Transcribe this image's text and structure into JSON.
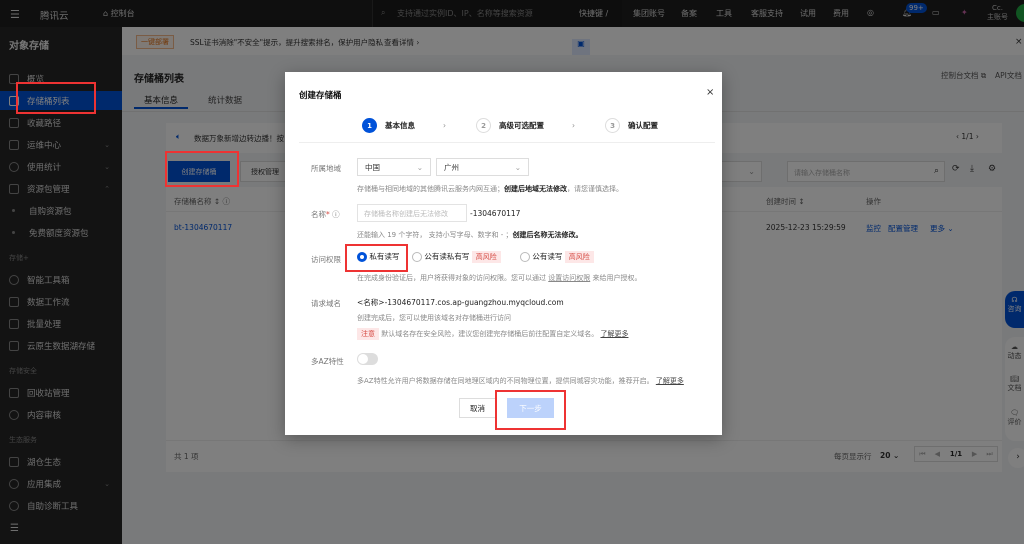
{
  "topbar": {
    "brand": "腾讯云",
    "console": "控制台",
    "search_placeholder": "支持通过实例ID、IP、名称等搜索资源",
    "shortcut": "快捷键 /",
    "nav": [
      "集团账号",
      "备案",
      "工具",
      "客服支持",
      "试用",
      "费用"
    ],
    "badge": "99+",
    "user_line1": "Cc.",
    "user_line2": "主账号"
  },
  "sidebar": {
    "title": "对象存储",
    "items": [
      {
        "label": "概览"
      },
      {
        "label": "存储桶列表",
        "active": true
      },
      {
        "label": "收藏路径"
      },
      {
        "label": "运维中心"
      },
      {
        "label": "使用统计"
      },
      {
        "label": "资源包管理"
      },
      {
        "label": "自购资源包"
      },
      {
        "label": "免费额度资源包"
      }
    ],
    "group_storage": "存储+",
    "storage_items": [
      {
        "label": "智能工具箱"
      },
      {
        "label": "数据工作流"
      },
      {
        "label": "批量处理"
      },
      {
        "label": "云原生数据湖存储"
      }
    ],
    "group_security": "存储安全",
    "security_items": [
      {
        "label": "回收站管理"
      },
      {
        "label": "内容审核"
      }
    ],
    "group_eco": "生态服务",
    "eco_items": [
      {
        "label": "湖仓生态"
      },
      {
        "label": "应用集成"
      },
      {
        "label": "自助诊断工具"
      }
    ]
  },
  "banner": {
    "tag": "一键部署",
    "text": "SSL证书消除\"不安全\"提示，提升搜索排名，保护用户隐私",
    "link": "查看详情 ›"
  },
  "page": {
    "title": "存储桶列表",
    "tabs": [
      "基本信息",
      "统计数据"
    ],
    "doc_link": "控制台文档",
    "api_link": "API文档",
    "notice": "数据万象新增边转边播！按",
    "notice_pager": "1/1",
    "create_button": "创建存储桶",
    "auth_button": "授权管理",
    "search_placeholder": "请输入存储桶名称",
    "columns": {
      "name": "存储桶名称",
      "created": "创建时间",
      "ops": "操作"
    },
    "rows": [
      {
        "name": "bt-1304670117",
        "created": "2025-12-23 15:29:59",
        "ops": [
          "监控",
          "配置管理",
          "更多"
        ]
      }
    ],
    "total": "共 1 项",
    "per_page_label": "每页显示行",
    "per_page": "20",
    "page": "1/1"
  },
  "modal": {
    "title": "创建存储桶",
    "steps": [
      {
        "num": "1",
        "label": "基本信息"
      },
      {
        "num": "2",
        "label": "高级可选配置"
      },
      {
        "num": "3",
        "label": "确认配置"
      }
    ],
    "region_label": "所属地域",
    "region_country": "中国",
    "region_city": "广州",
    "region_help": "存储桶与相同地域的其他腾讯云服务内网互通；",
    "region_help_bold": "创建后地域无法修改",
    "region_help_tail": "，请您谨慎选择。",
    "name_label": "名称",
    "name_placeholder": "存储桶名称创建后无法修改",
    "name_suffix": "-1304670117",
    "name_help": "还能输入 19 个字符， 支持小写字母、数字和 - ；",
    "name_help_bold": "创建后名称无法修改。",
    "access_label": "访问权限",
    "access_options": [
      {
        "label": "私有读写",
        "selected": true
      },
      {
        "label": "公有读私有写",
        "risk": "高风险"
      },
      {
        "label": "公有读写",
        "risk": "高风险"
      }
    ],
    "access_help": "在完成身份验证后，用户将获得对象的访问权限。您可以通过",
    "access_help_link": "设置访问权限",
    "access_help_tail": "来给用户授权。",
    "domain_label": "请求域名",
    "domain": "<名称>-1304670117.cos.ap-guangzhou.myqcloud.com",
    "domain_help": "创建完成后，您可以使用该域名对存储桶进行访问",
    "notice_tag": "注意",
    "notice_text": "默认域名存在安全风险，建议您创建完存储桶后前往配置自定义域名。",
    "learn_more": "了解更多",
    "az_label": "多AZ特性",
    "az_enabled": false,
    "az_help": "多AZ特性允许用户将数据存储在同地理区域内的不同物理位置，提供同城容灾功能，推荐开启。",
    "cancel": "取消",
    "next": "下一步"
  },
  "float": {
    "consult": "咨询",
    "dynamic": "动态",
    "docs": "文档",
    "review": "评价"
  }
}
